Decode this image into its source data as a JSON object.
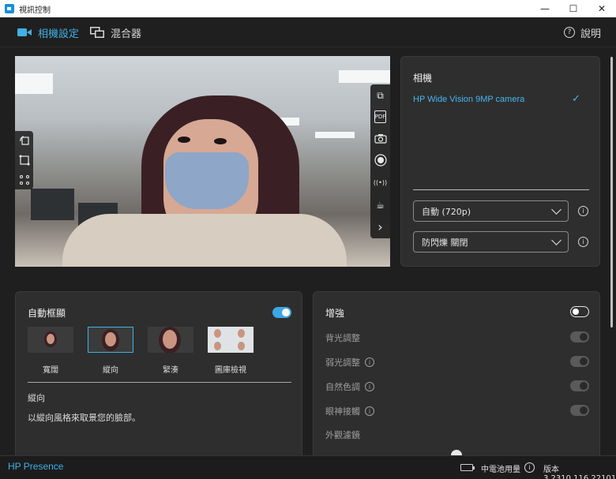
{
  "window": {
    "title": "視訊控制",
    "controls": [
      "—",
      "☐",
      "✕"
    ]
  },
  "nav": {
    "tabs": [
      {
        "label": "相機設定",
        "active": true,
        "icon": "video-camera-icon"
      },
      {
        "label": "混合器",
        "active": false,
        "icon": "mixer-screens-icon"
      }
    ],
    "help_label": "說明",
    "help_glyph": "?"
  },
  "preview": {
    "left_tools": [
      "rotate-icon",
      "crop-auto-icon",
      "frame-points-icon"
    ],
    "right_tools": [
      "pop-out-icon",
      "pdf-icon",
      "snapshot-camera-icon",
      "record-icon",
      "broadcast-icon",
      "coffee-cup-icon",
      "expand-chevron-icon"
    ],
    "right_tool_glyphs": [
      "⧉",
      "PDF",
      "◉",
      "●",
      "((•))",
      "☕",
      "›"
    ]
  },
  "camera_panel": {
    "title": "相機",
    "device_name": "HP Wide Vision 9MP camera",
    "selected_glyph": "✓",
    "resolution_select": "自動 (720p)",
    "flicker_select": "防閃爍 關閉",
    "info_glyph": "i"
  },
  "auto_framing": {
    "title": "自動框顯",
    "enabled": true,
    "options": [
      {
        "label": "寬闊",
        "selected": false
      },
      {
        "label": "縱向",
        "selected": true
      },
      {
        "label": "緊湊",
        "selected": false
      },
      {
        "label": "圖庫檢視",
        "selected": false
      }
    ],
    "selected_title": "縱向",
    "selected_description": "以縱向風格來取景您的臉部。"
  },
  "enhancement": {
    "title": "增強",
    "enabled": false,
    "items": [
      {
        "label": "背光調整",
        "has_info": false
      },
      {
        "label": "弱光調整",
        "has_info": true
      },
      {
        "label": "自然色調",
        "has_info": true
      },
      {
        "label": "眼神接觸",
        "has_info": true
      }
    ],
    "filter_label": "外觀濾鏡"
  },
  "status": {
    "brand": "HP Presence",
    "battery_text": "中電池用量",
    "info_glyph": "i",
    "version": "版本 3.2310.116.22101"
  },
  "colors": {
    "accent": "#3fb1e6",
    "background": "#1f1f1f",
    "panel": "#2e2e2e"
  }
}
